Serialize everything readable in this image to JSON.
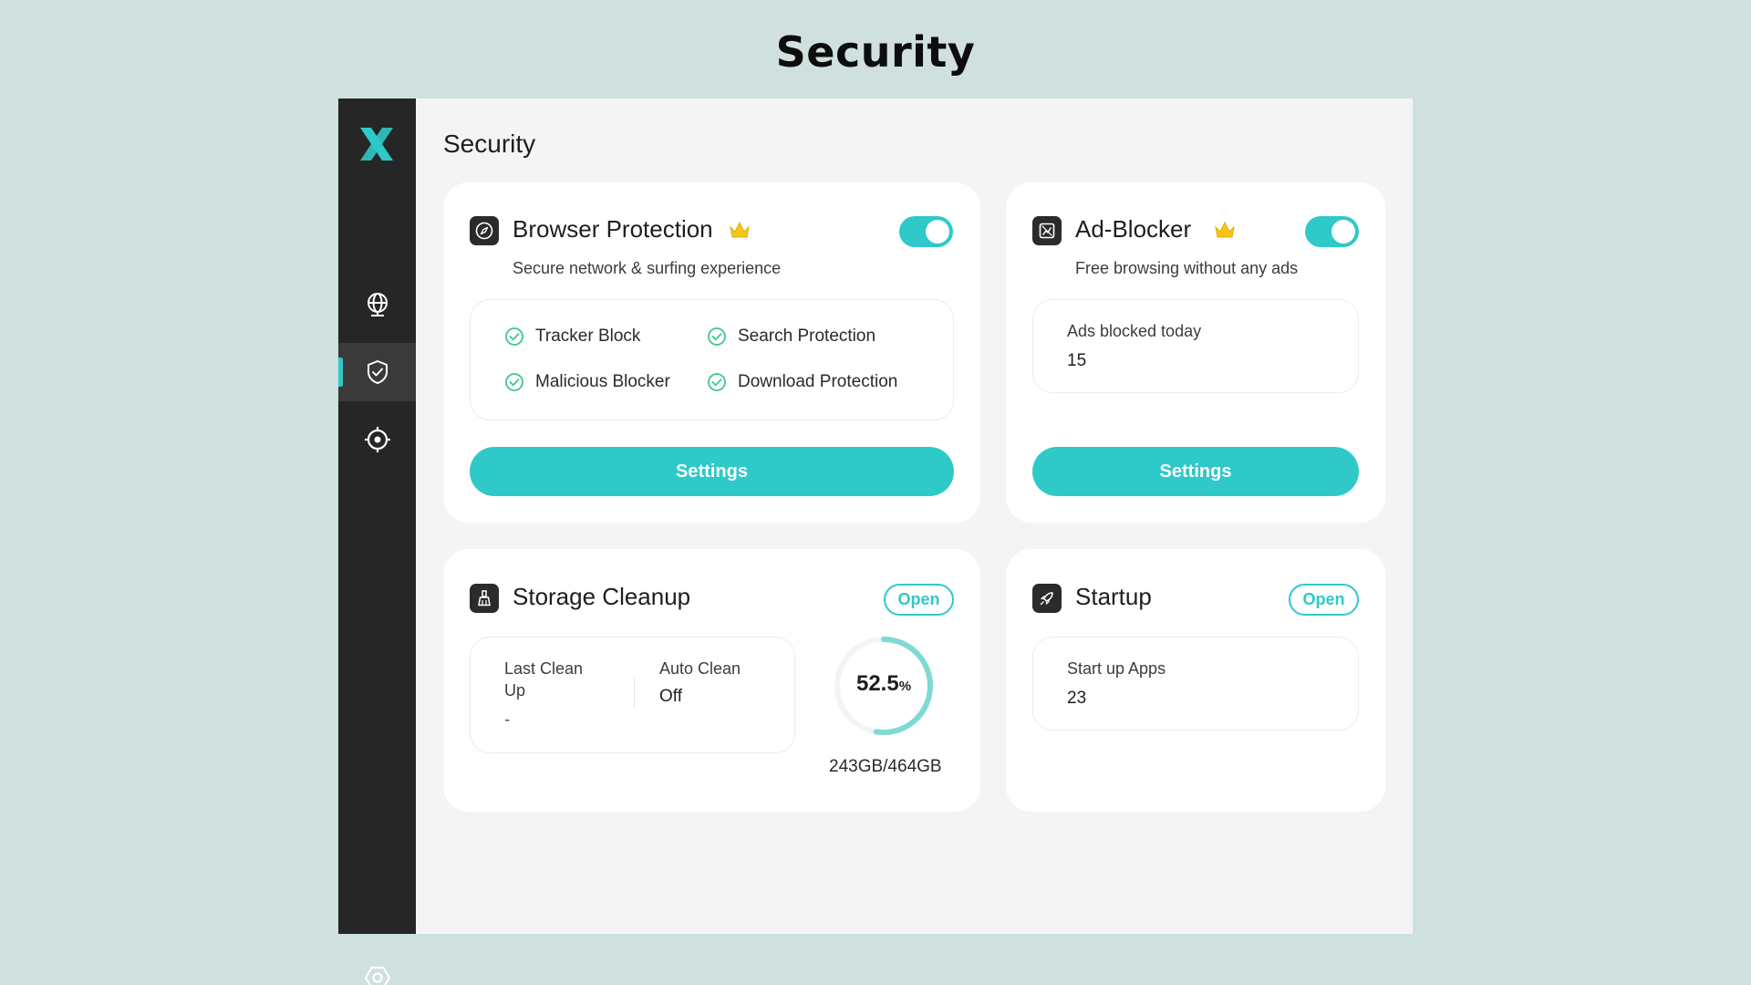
{
  "page_heading": "Security",
  "sidebar": {
    "logo_icon": "x-logo-icon",
    "items": [
      {
        "id": "globe",
        "icon": "globe-icon",
        "active": false
      },
      {
        "id": "security",
        "icon": "shield-check-icon",
        "active": true
      },
      {
        "id": "target",
        "icon": "crosshair-icon",
        "active": false
      },
      {
        "id": "settings",
        "icon": "hex-gear-icon",
        "active": false
      }
    ]
  },
  "main": {
    "title": "Security",
    "browser_protection": {
      "title": "Browser Protection",
      "subtitle": "Secure network & surfing experience",
      "enabled": true,
      "features": [
        "Tracker Block",
        "Search Protection",
        "Malicious Blocker",
        "Download Protection"
      ],
      "button_label": "Settings"
    },
    "ad_blocker": {
      "title": "Ad-Blocker",
      "subtitle": "Free browsing without any ads",
      "enabled": true,
      "stat_label": "Ads blocked today",
      "stat_value": "15",
      "button_label": "Settings"
    },
    "storage_cleanup": {
      "title": "Storage Cleanup",
      "open_label": "Open",
      "last_clean_label_line1": "Last Clean",
      "last_clean_label_line2": "Up",
      "last_clean_value": "-",
      "auto_clean_label": "Auto Clean",
      "auto_clean_value": "Off",
      "usage_number": "52.5",
      "usage_unit": "%",
      "usage_fraction": 0.525,
      "capacity": "243GB/464GB"
    },
    "startup": {
      "title": "Startup",
      "open_label": "Open",
      "stat_label": "Start up Apps",
      "stat_value": "23"
    }
  },
  "colors": {
    "accent": "#2ec9c8",
    "sidebar": "#262626",
    "background": "#cfe0df",
    "crown": "#f5c518"
  }
}
